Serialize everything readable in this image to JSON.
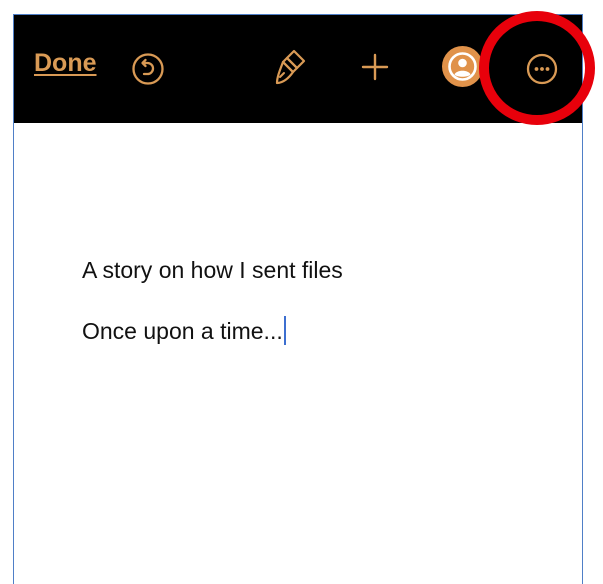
{
  "toolbar": {
    "done_label": "Done",
    "icons": [
      "undo-icon",
      "paintbrush-icon",
      "plus-icon",
      "avatar-icon",
      "more-icon"
    ],
    "accent_color": "#d99a55",
    "background_color": "#000000"
  },
  "document": {
    "lines": [
      "A story on how I sent files",
      "Once upon a time..."
    ]
  },
  "annotation": {
    "highlight_color": "#e8000b",
    "target": "more-icon"
  }
}
